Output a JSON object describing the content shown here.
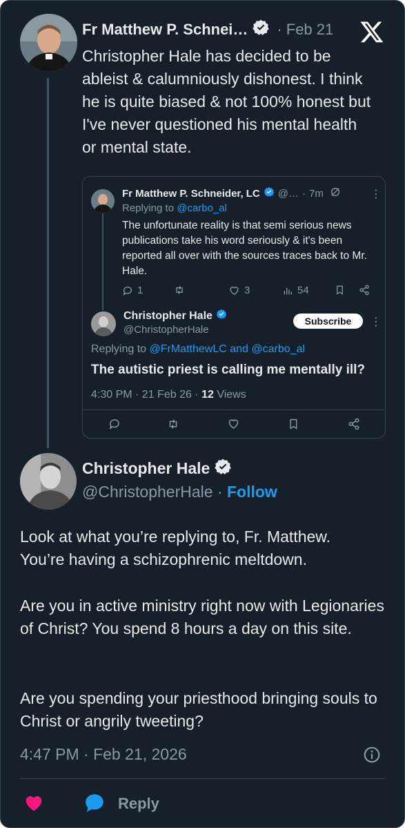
{
  "main_tweet": {
    "author_name": "Fr Matthew P. Schnei…",
    "date": "Feb 21",
    "text": "Christopher Hale has decided to be ableist & calumniously dishonest. I think he is quite biased & not 100% honest but I've never questioned his mental health or mental state."
  },
  "quoted": {
    "author_name": "Fr Matthew P. Schneider, LC",
    "handle": "@…",
    "time": "7m",
    "replying_label": "Replying to",
    "replying_to": "@carbo_al",
    "text": "The unfortunate reality is that semi serious news publications take his word seriously & it's been reported all over with the sources traces back to Mr. Hale.",
    "stats": {
      "replies": "1",
      "likes": "3",
      "views": "54"
    },
    "reply": {
      "author_name": "Christopher Hale",
      "handle": "@ChristopherHale",
      "subscribe_label": "Subscribe",
      "replying_label": "Replying to",
      "replying_to": "@FrMatthewLC and @carbo_al",
      "text": "The autistic priest is calling me mentally ill?",
      "timestamp": "4:30 PM · 21 Feb 26 · ",
      "views_count": "12",
      "views_label": "Views"
    }
  },
  "reply_tweet": {
    "author_name": "Christopher Hale",
    "handle": "@ChristopherHale",
    "separator": "·",
    "follow_label": "Follow",
    "paragraphs": [
      "Look at what you’re replying to, Fr. Matthew. You’re having a schizophrenic meltdown.",
      "Are you in active ministry right now with Legionaries of Christ? You spend 8 hours a day on this site.",
      "Are you spending your priesthood bringing souls to Christ or angrily tweeting?"
    ],
    "timestamp": "4:47 PM · Feb 21, 2026",
    "reply_label": "Reply"
  },
  "colors": {
    "background": "#15202b",
    "accent": "#1d9bf0",
    "like": "#f91880",
    "text": "#e7e9ea",
    "muted": "#8b98a5"
  },
  "icons": [
    "verified-badge-icon",
    "x-logo-icon",
    "heart-icon",
    "speech-bubble-icon",
    "info-icon",
    "retweet-icon",
    "bookmark-icon",
    "share-icon",
    "views-icon",
    "grok-icon",
    "more-icon"
  ]
}
